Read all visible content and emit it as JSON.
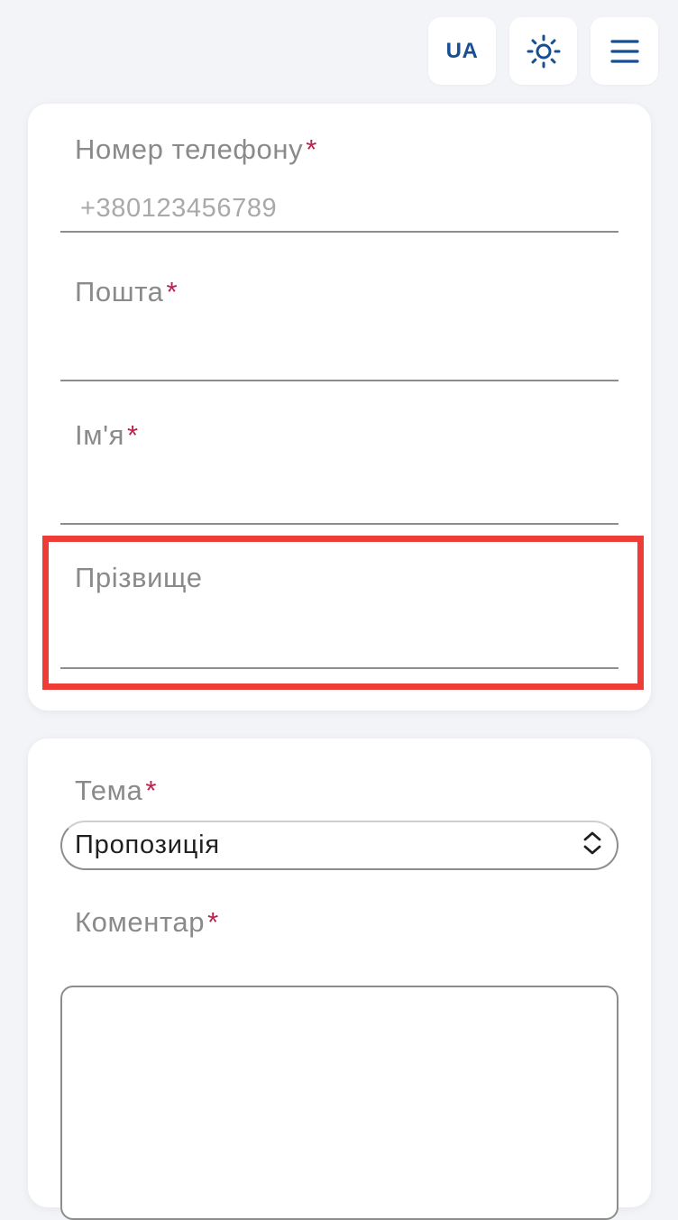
{
  "header": {
    "lang_label": "UA",
    "theme_icon": "sun-icon",
    "menu_icon": "hamburger-menu-icon",
    "accent_color": "#164f93"
  },
  "contact_form": {
    "phone": {
      "label": "Номер телефону",
      "required_mark": "*",
      "placeholder": "+380123456789",
      "value": ""
    },
    "email": {
      "label": "Пошта",
      "required_mark": "*",
      "value": ""
    },
    "first_name": {
      "label": "Ім'я",
      "required_mark": "*",
      "value": ""
    },
    "last_name": {
      "label": "Прізвище",
      "value": ""
    }
  },
  "message_form": {
    "topic": {
      "label": "Тема",
      "required_mark": "*",
      "selected": "Пропозиція",
      "icon": "chevron-up-down-icon"
    },
    "comment": {
      "label": "Коментар",
      "required_mark": "*",
      "value": ""
    }
  },
  "colors": {
    "required": "#b7234d",
    "highlight": "#ee3d37"
  }
}
